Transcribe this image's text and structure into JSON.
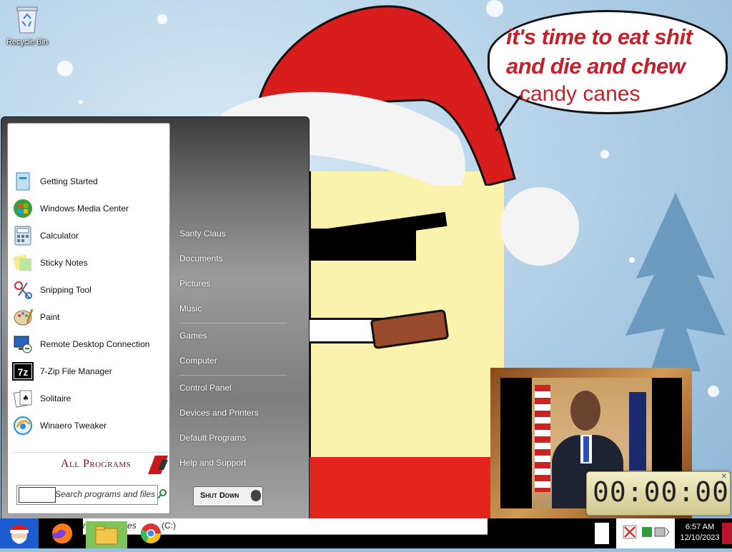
{
  "desktop": {
    "icons": [
      {
        "label": "Recycle Bin"
      }
    ],
    "wallpaper": {
      "speech_line1": "it's time to eat shit",
      "speech_line2": "and die and chew",
      "speech_line3": "candy canes"
    }
  },
  "start_menu": {
    "programs": [
      {
        "label": "Getting Started",
        "icon": "getting-started-icon"
      },
      {
        "label": "Windows Media Center",
        "icon": "media-center-icon"
      },
      {
        "label": "Calculator",
        "icon": "calculator-icon"
      },
      {
        "label": "Sticky Notes",
        "icon": "sticky-notes-icon"
      },
      {
        "label": "Snipping Tool",
        "icon": "scissors-icon"
      },
      {
        "label": "Paint",
        "icon": "paint-palette-icon"
      },
      {
        "label": "Remote Desktop Connection",
        "icon": "remote-desktop-icon"
      },
      {
        "label": "7-Zip File Manager",
        "icon": "seven-zip-icon"
      },
      {
        "label": "Solitaire",
        "icon": "solitaire-icon"
      },
      {
        "label": "Winaero Tweaker",
        "icon": "winaero-tweaker-icon"
      }
    ],
    "all_programs": "All Programs",
    "search_placeholder": "Search programs and files",
    "right_links": [
      "Santy Claus",
      "Documents",
      "Pictures",
      "Music",
      "Games",
      "Computer",
      "Control Panel",
      "Devices and Printers",
      "Default Programs",
      "Help and Support"
    ],
    "shutdown": "Shut Down"
  },
  "clock_widget": {
    "value": "00:00:00"
  },
  "taskbar": {
    "strip_text": "rams and files",
    "strip_drive": "(C:)",
    "time": "6:57 AM",
    "date": "12/10/2023",
    "colors": {
      "start": "#1c5bd0",
      "accent": "#b8142b"
    }
  }
}
